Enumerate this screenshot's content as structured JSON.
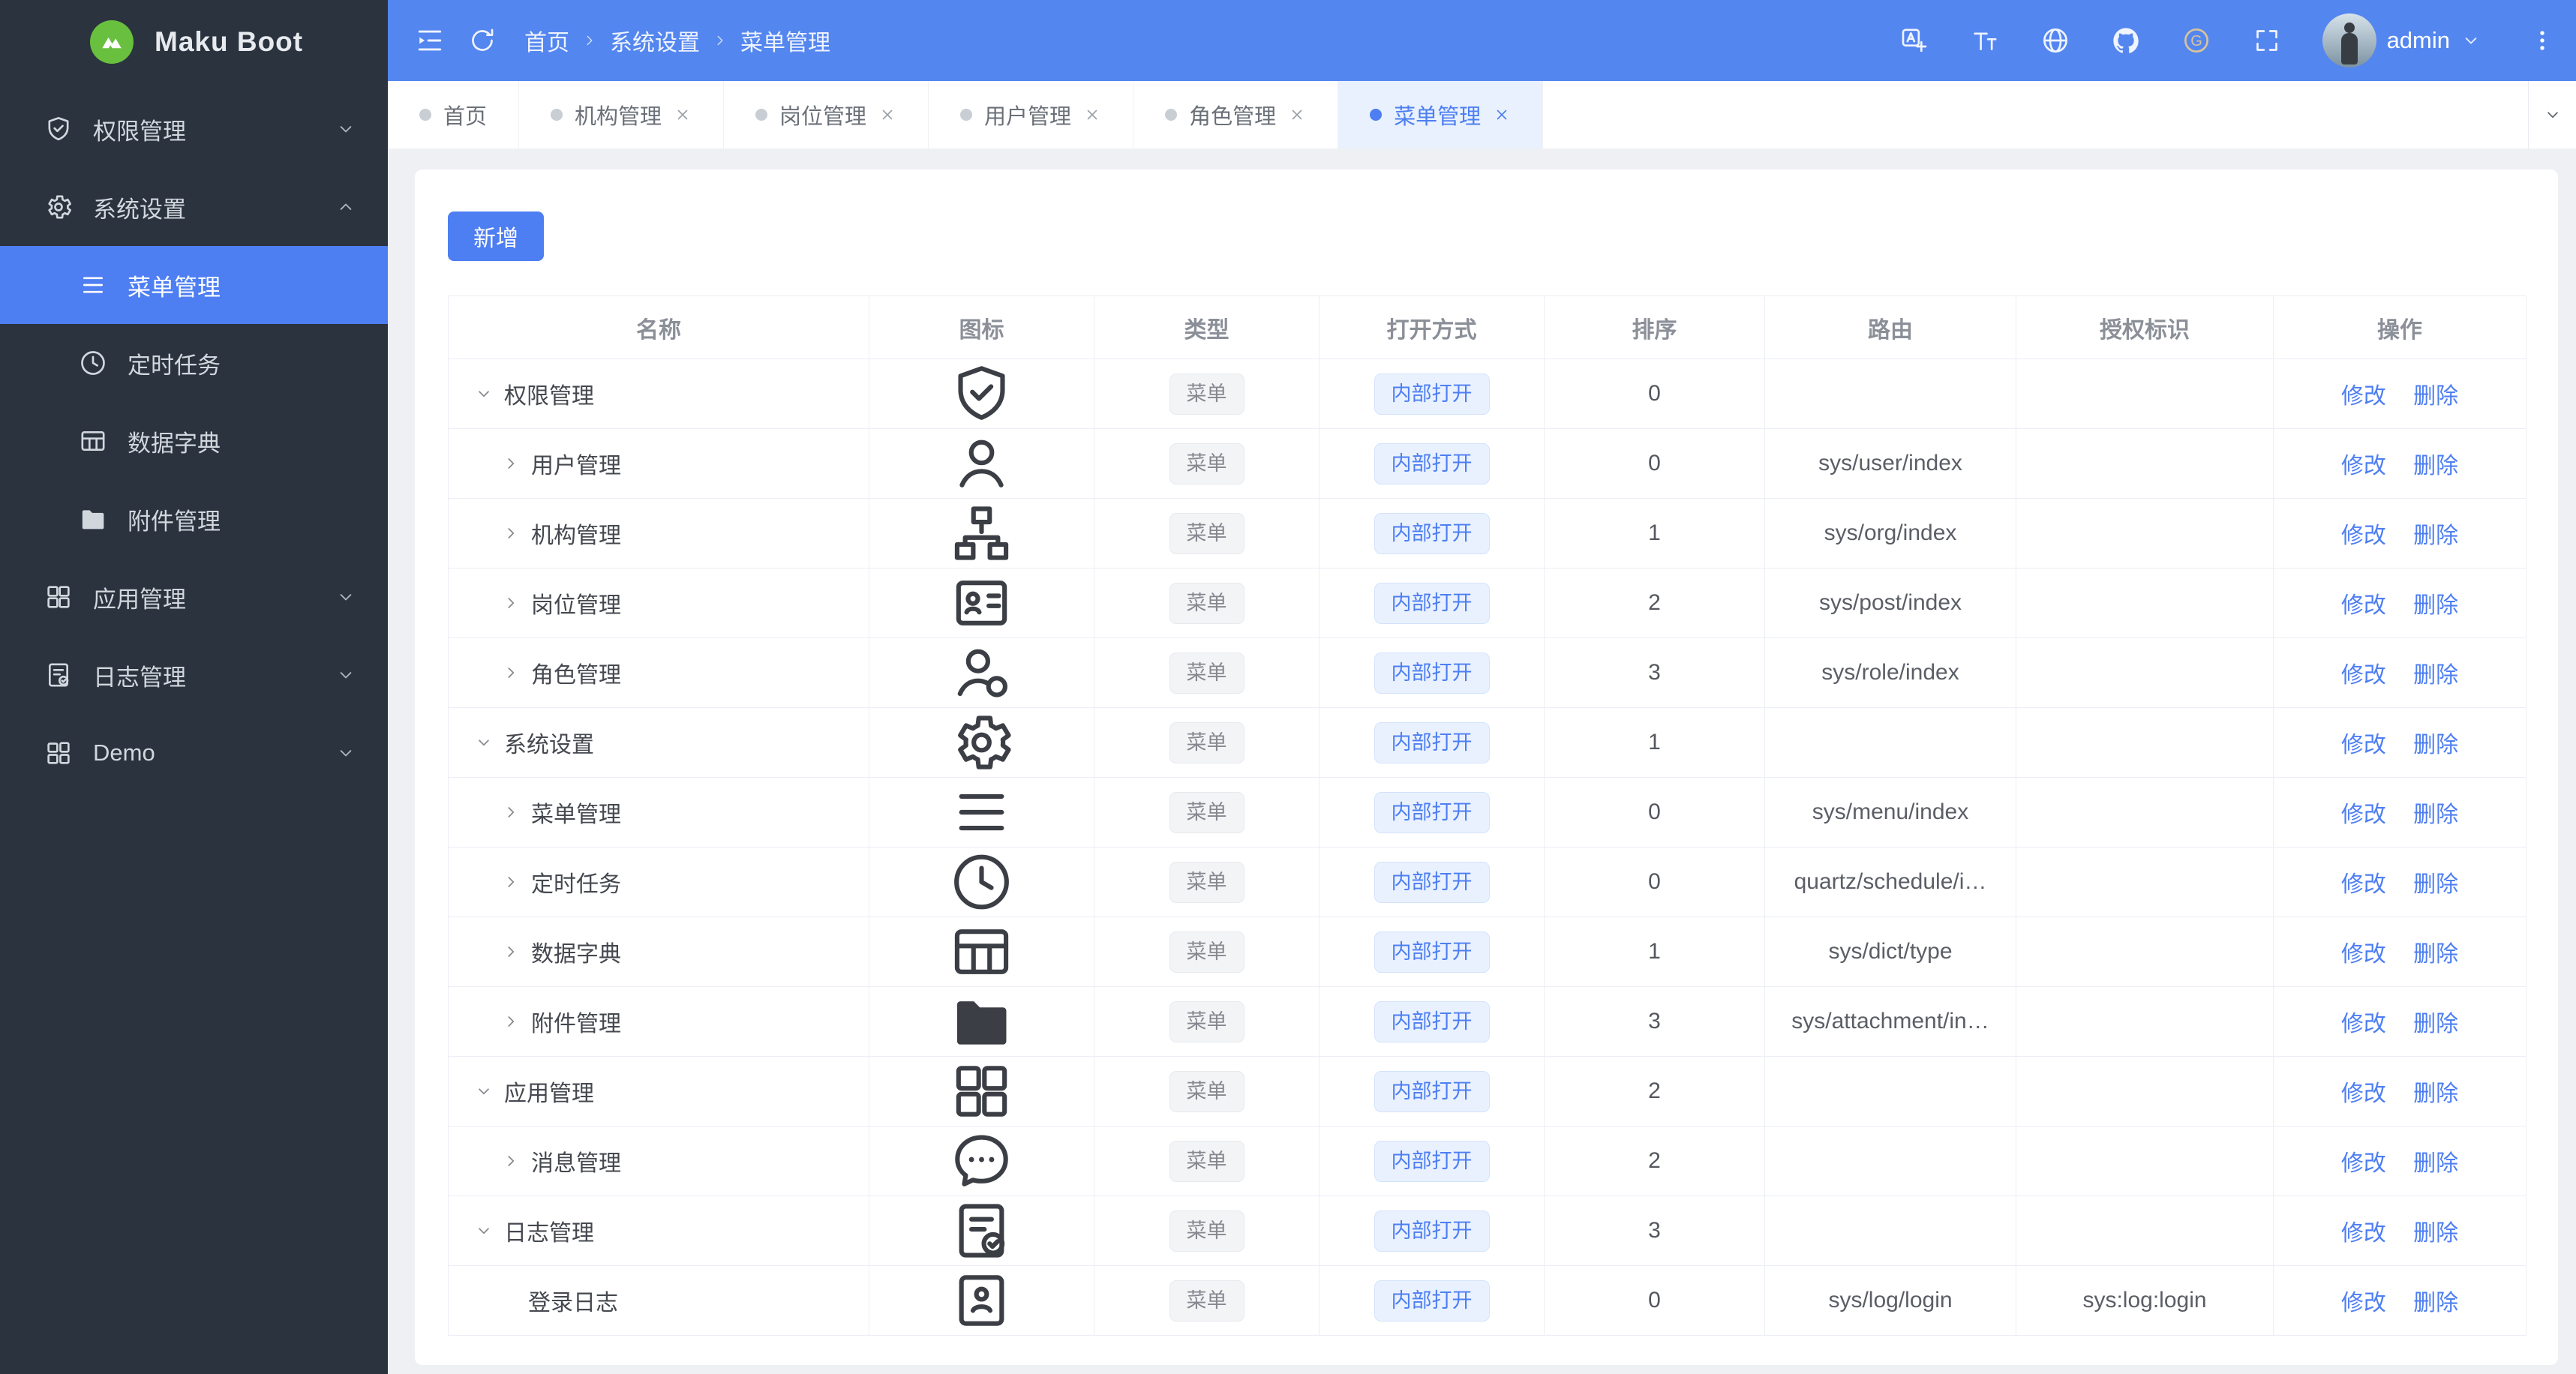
{
  "app": {
    "logo_text": "Maku Boot"
  },
  "topbar": {
    "breadcrumb": [
      "首页",
      "系统设置",
      "菜单管理"
    ],
    "action_icons": [
      "translate-icon",
      "font-size-icon",
      "globe-icon",
      "github-icon",
      "gitee-icon",
      "fullscreen-icon"
    ],
    "user_name": "admin"
  },
  "sidebar": {
    "items": [
      {
        "label": "权限管理",
        "icon": "shield-check-icon",
        "chevron": "down"
      },
      {
        "label": "系统设置",
        "icon": "gear-icon",
        "chevron": "up",
        "expanded": true,
        "children": [
          {
            "label": "菜单管理",
            "icon": "menu-icon",
            "active": true
          },
          {
            "label": "定时任务",
            "icon": "clock-icon"
          },
          {
            "label": "数据字典",
            "icon": "dict-table-icon"
          },
          {
            "label": "附件管理",
            "icon": "folder-icon"
          }
        ]
      },
      {
        "label": "应用管理",
        "icon": "apps-icon",
        "chevron": "down"
      },
      {
        "label": "日志管理",
        "icon": "log-doc-icon",
        "chevron": "down"
      },
      {
        "label": "Demo",
        "icon": "demo-icon",
        "chevron": "down"
      }
    ]
  },
  "tabs": [
    {
      "label": "首页",
      "closable": false,
      "active": false
    },
    {
      "label": "机构管理",
      "closable": true,
      "active": false
    },
    {
      "label": "岗位管理",
      "closable": true,
      "active": false
    },
    {
      "label": "用户管理",
      "closable": true,
      "active": false
    },
    {
      "label": "角色管理",
      "closable": true,
      "active": false
    },
    {
      "label": "菜单管理",
      "closable": true,
      "active": true
    }
  ],
  "toolbar": {
    "add_label": "新增"
  },
  "table": {
    "columns": [
      "名称",
      "图标",
      "类型",
      "打开方式",
      "排序",
      "路由",
      "授权标识",
      "操作"
    ],
    "edit_label": "修改",
    "delete_label": "删除",
    "rows": [
      {
        "name": "权限管理",
        "icon": "shield-check-icon",
        "arrow": "down",
        "level": 0,
        "type": "菜单",
        "open": "内部打开",
        "sort": "0",
        "route": "",
        "perm": ""
      },
      {
        "name": "用户管理",
        "icon": "user-icon",
        "arrow": "right",
        "level": 1,
        "type": "菜单",
        "open": "内部打开",
        "sort": "0",
        "route": "sys/user/index",
        "perm": ""
      },
      {
        "name": "机构管理",
        "icon": "org-icon",
        "arrow": "right",
        "level": 1,
        "type": "菜单",
        "open": "内部打开",
        "sort": "1",
        "route": "sys/org/index",
        "perm": ""
      },
      {
        "name": "岗位管理",
        "icon": "postcard-icon",
        "arrow": "right",
        "level": 1,
        "type": "菜单",
        "open": "内部打开",
        "sort": "2",
        "route": "sys/post/index",
        "perm": ""
      },
      {
        "name": "角色管理",
        "icon": "role-user-icon",
        "arrow": "right",
        "level": 1,
        "type": "菜单",
        "open": "内部打开",
        "sort": "3",
        "route": "sys/role/index",
        "perm": ""
      },
      {
        "name": "系统设置",
        "icon": "gear-icon",
        "arrow": "down",
        "level": 0,
        "type": "菜单",
        "open": "内部打开",
        "sort": "1",
        "route": "",
        "perm": ""
      },
      {
        "name": "菜单管理",
        "icon": "menu-icon",
        "arrow": "right",
        "level": 1,
        "type": "菜单",
        "open": "内部打开",
        "sort": "0",
        "route": "sys/menu/index",
        "perm": ""
      },
      {
        "name": "定时任务",
        "icon": "clock-icon",
        "arrow": "right",
        "level": 1,
        "type": "菜单",
        "open": "内部打开",
        "sort": "0",
        "route": "quartz/schedule/i…",
        "perm": ""
      },
      {
        "name": "数据字典",
        "icon": "dict-table-icon",
        "arrow": "right",
        "level": 1,
        "type": "菜单",
        "open": "内部打开",
        "sort": "1",
        "route": "sys/dict/type",
        "perm": ""
      },
      {
        "name": "附件管理",
        "icon": "folder-icon",
        "arrow": "right",
        "level": 1,
        "type": "菜单",
        "open": "内部打开",
        "sort": "3",
        "route": "sys/attachment/in…",
        "perm": ""
      },
      {
        "name": "应用管理",
        "icon": "apps-icon",
        "arrow": "down",
        "level": 0,
        "type": "菜单",
        "open": "内部打开",
        "sort": "2",
        "route": "",
        "perm": ""
      },
      {
        "name": "消息管理",
        "icon": "message-icon",
        "arrow": "right",
        "level": 1,
        "type": "菜单",
        "open": "内部打开",
        "sort": "2",
        "route": "",
        "perm": ""
      },
      {
        "name": "日志管理",
        "icon": "log-doc-icon",
        "arrow": "down",
        "level": 0,
        "type": "菜单",
        "open": "内部打开",
        "sort": "3",
        "route": "",
        "perm": ""
      },
      {
        "name": "登录日志",
        "icon": "login-log-icon",
        "arrow": "none",
        "level": 2,
        "type": "菜单",
        "open": "内部打开",
        "sort": "0",
        "route": "sys/log/login",
        "perm": "sys:log:login"
      }
    ]
  },
  "colors": {
    "primary": "#4d7ef2",
    "header_blue": "#5486ef",
    "sidebar_bg": "#2a333e",
    "logo_green": "#69c03f"
  }
}
